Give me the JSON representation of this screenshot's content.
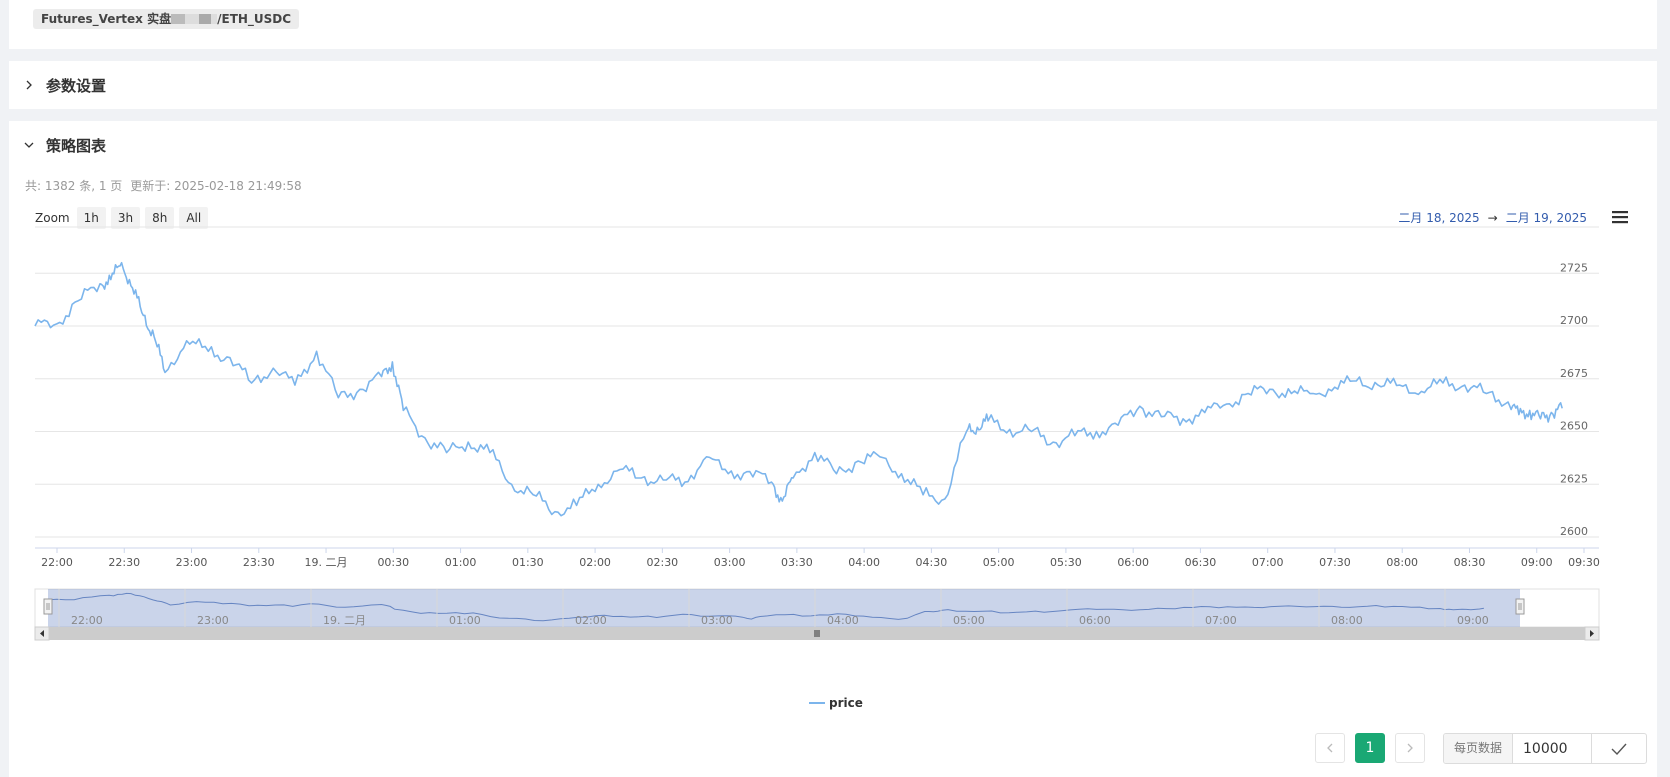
{
  "top": {
    "tag_prefix": "Futures_Vertex 实盘",
    "tag_suffix": "/ETH_USDC"
  },
  "sections": {
    "params_title": "参数设置",
    "chart_title": "策略图表"
  },
  "meta": {
    "count_text": "共: 1382 条, 1 页",
    "updated_text": "更新于: 2025-02-18 21:49:58"
  },
  "zoom": {
    "label": "Zoom",
    "buttons": [
      "1h",
      "3h",
      "8h",
      "All"
    ]
  },
  "range": {
    "from": "二月 18, 2025",
    "arrow": "→",
    "to": "二月 19, 2025"
  },
  "chart_data": {
    "type": "line",
    "title": "",
    "series": [
      {
        "name": "price",
        "color": "#7cb5ec",
        "x": [
          "21:50",
          "22:00",
          "22:10",
          "22:20",
          "22:25",
          "22:30",
          "22:35",
          "22:40",
          "22:45",
          "22:50",
          "23:00",
          "23:10",
          "23:20",
          "23:30",
          "23:40",
          "23:50",
          "00:00",
          "00:10",
          "00:20",
          "00:30",
          "00:35",
          "00:40",
          "00:50",
          "01:00",
          "01:10",
          "01:20",
          "01:30",
          "01:40",
          "01:50",
          "02:00",
          "02:10",
          "02:20",
          "02:30",
          "02:40",
          "02:50",
          "03:00",
          "03:10",
          "03:20",
          "03:30",
          "03:35",
          "03:40",
          "03:50",
          "04:00",
          "04:10",
          "04:20",
          "04:30",
          "04:40",
          "04:50",
          "05:00",
          "05:05",
          "05:10",
          "05:20",
          "05:30",
          "05:40",
          "05:50",
          "06:00",
          "06:10",
          "06:20",
          "06:30",
          "06:40",
          "06:50",
          "07:00",
          "07:10",
          "07:20",
          "07:30",
          "07:40",
          "07:50",
          "08:00",
          "08:10",
          "08:20",
          "08:30",
          "08:40",
          "08:50",
          "09:00",
          "09:10",
          "09:15",
          "09:20",
          "09:25",
          "09:30",
          "09:35"
        ],
        "values": [
          2700,
          2701,
          2712,
          2720,
          2722,
          2730,
          2718,
          2705,
          2695,
          2678,
          2693,
          2688,
          2685,
          2673,
          2680,
          2672,
          2688,
          2666,
          2670,
          2676,
          2683,
          2660,
          2647,
          2640,
          2645,
          2640,
          2625,
          2620,
          2612,
          2615,
          2625,
          2632,
          2628,
          2627,
          2626,
          2638,
          2630,
          2631,
          2626,
          2617,
          2628,
          2640,
          2630,
          2636,
          2638,
          2630,
          2620,
          2618,
          2650,
          2652,
          2655,
          2651,
          2650,
          2645,
          2648,
          2650,
          2653,
          2662,
          2657,
          2656,
          2659,
          2663,
          2668,
          2670,
          2668,
          2668,
          2671,
          2674,
          2672,
          2672,
          2669,
          2673,
          2672,
          2668,
          2664,
          2658,
          2660,
          2656,
          2659,
          2661
        ]
      }
    ],
    "x_ticks": [
      "22:00",
      "22:30",
      "23:00",
      "23:30",
      "19. 二月",
      "00:30",
      "01:00",
      "01:30",
      "02:00",
      "02:30",
      "03:00",
      "03:30",
      "04:00",
      "04:30",
      "05:00",
      "05:30",
      "06:00",
      "06:30",
      "07:00",
      "07:30",
      "08:00",
      "08:30",
      "09:00",
      "09:30"
    ],
    "y_ticks": [
      2600,
      2625,
      2650,
      2675,
      2700,
      2725
    ],
    "ylim": [
      2600,
      2750
    ],
    "navigator_ticks": [
      "22:00",
      "23:00",
      "19. 二月",
      "01:00",
      "02:00",
      "03:00",
      "04:00",
      "05:00",
      "06:00",
      "07:00",
      "08:00",
      "09:00"
    ],
    "grid": "horizontal",
    "legend": "bottom-center"
  },
  "pagination": {
    "current_page": "1",
    "page_size_label": "每页数据",
    "page_size_value": "10000"
  }
}
